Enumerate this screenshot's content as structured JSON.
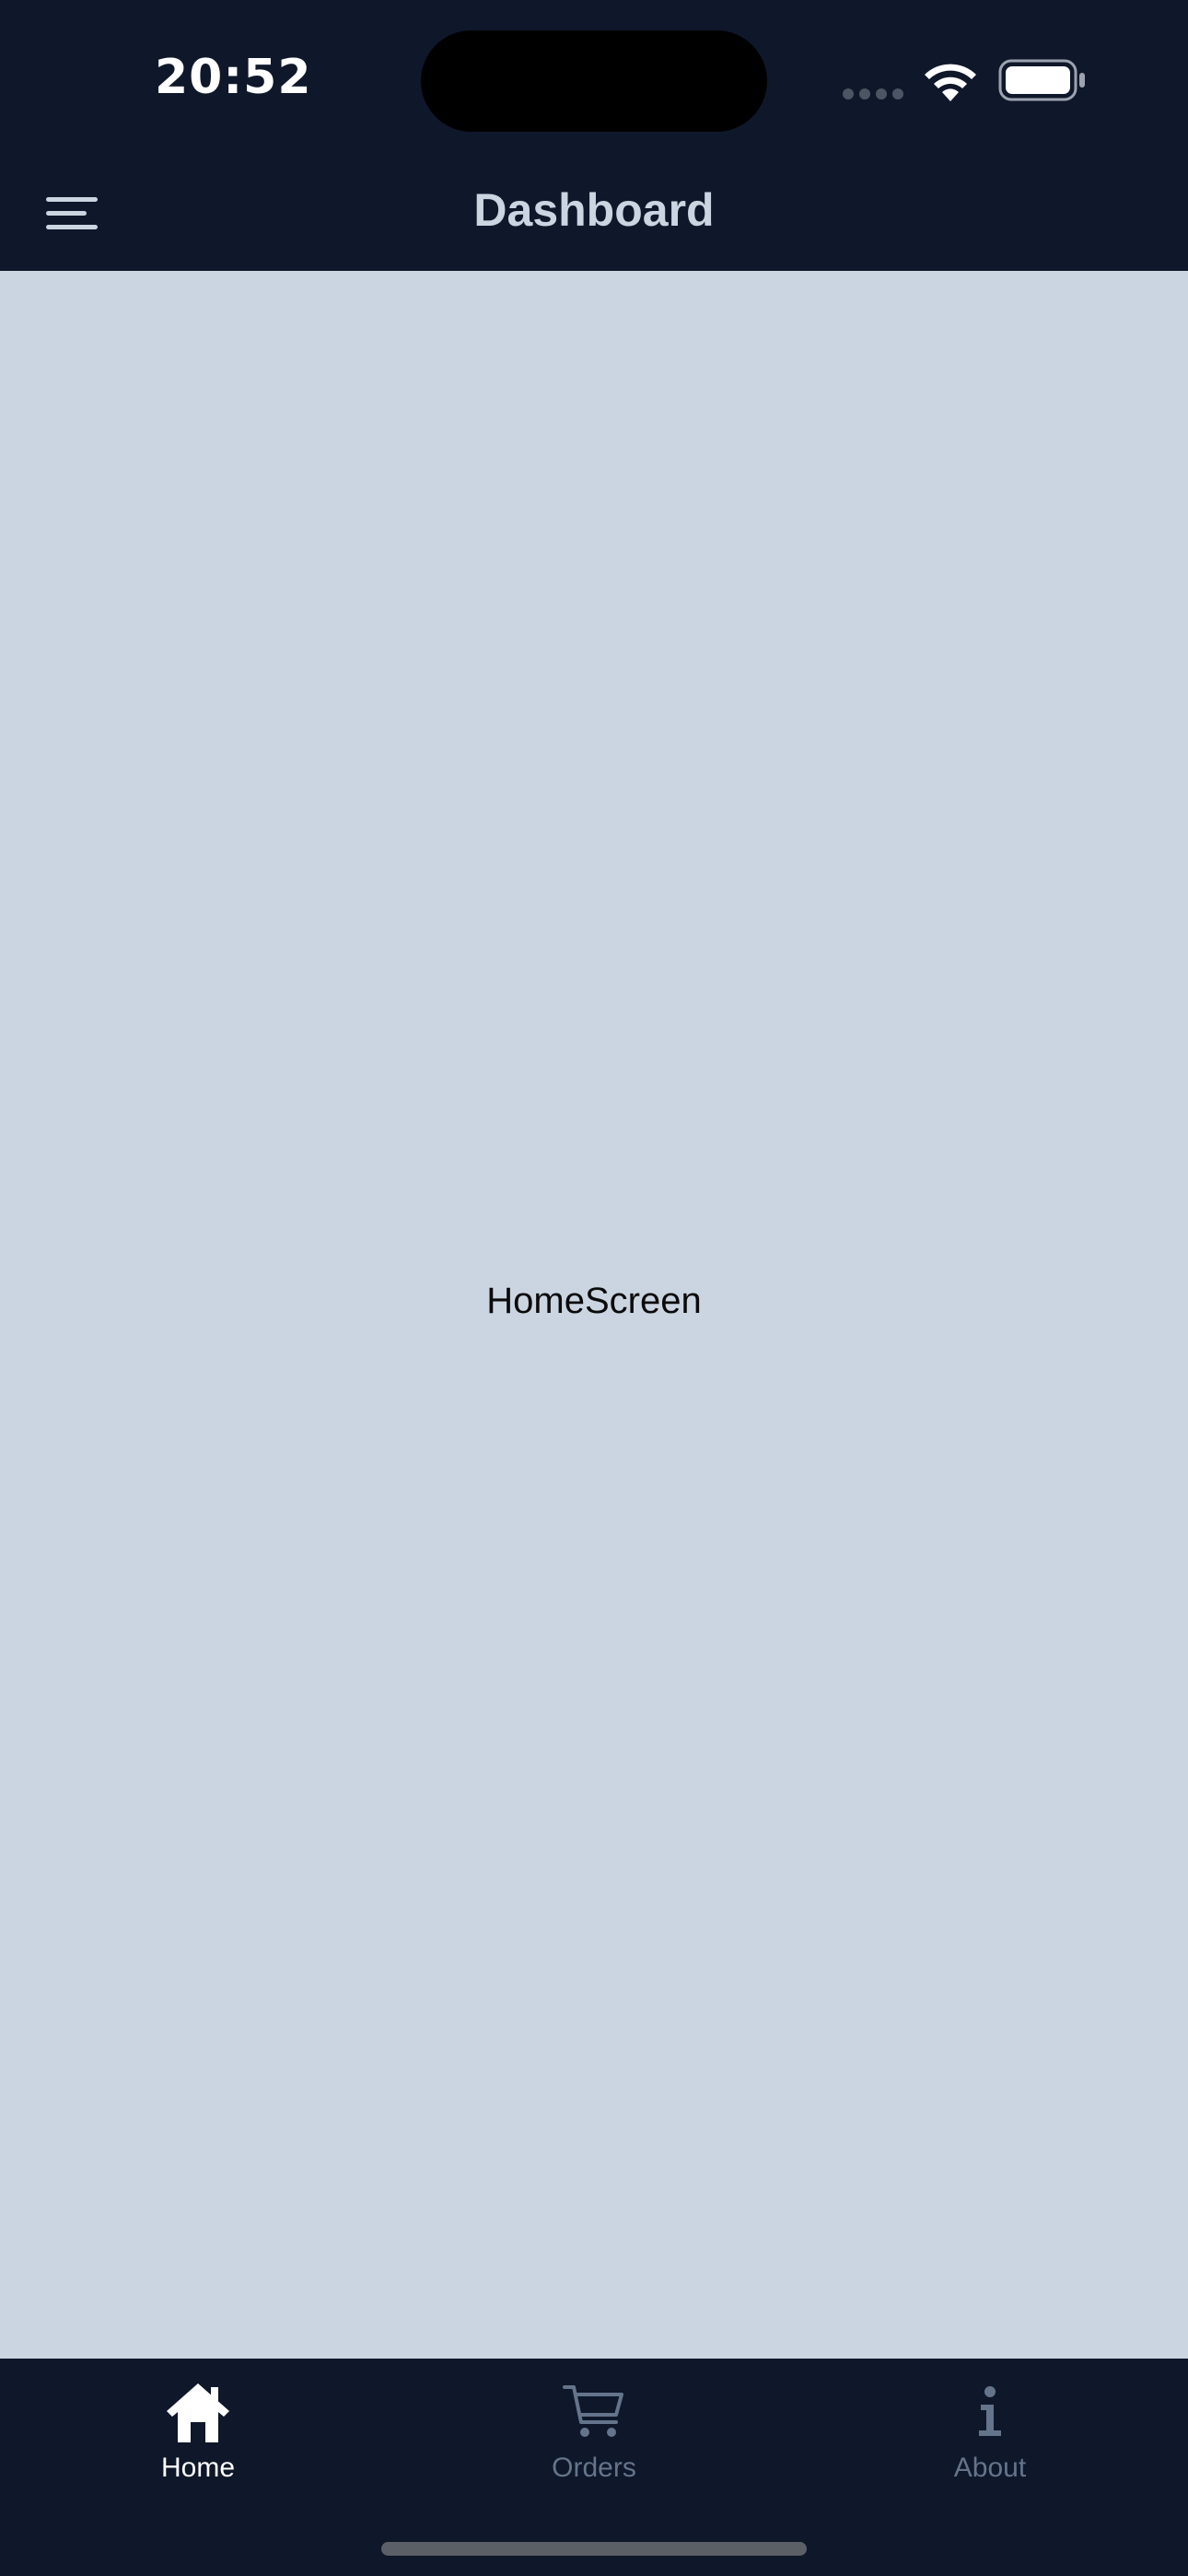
{
  "status_bar": {
    "time": "20:52"
  },
  "header": {
    "title": "Dashboard",
    "menu_icon": "hamburger-menu-icon"
  },
  "main": {
    "text": "HomeScreen"
  },
  "tab_bar": {
    "tabs": [
      {
        "label": "Home",
        "icon": "home-icon",
        "active": true
      },
      {
        "label": "Orders",
        "icon": "cart-icon",
        "active": false
      },
      {
        "label": "About",
        "icon": "info-icon",
        "active": false
      }
    ]
  },
  "colors": {
    "bar_background": "#0f172a",
    "content_background": "#cbd5e1",
    "header_title": "#cbd5e1",
    "tab_active": "#ffffff",
    "tab_inactive": "#64748b"
  }
}
